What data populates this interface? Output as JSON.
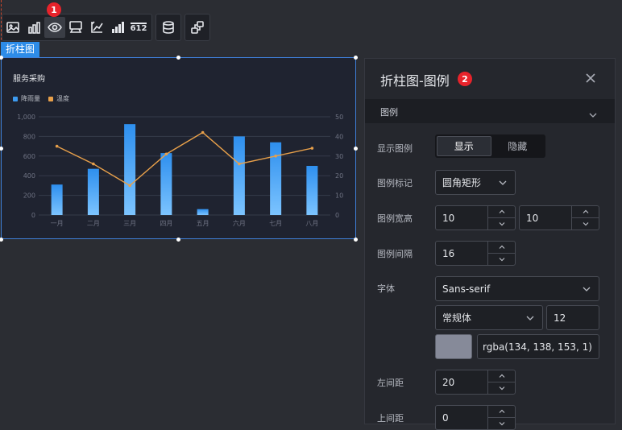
{
  "badges": {
    "first": "1",
    "second": "2"
  },
  "toolbar": {
    "icons": [
      "image-icon",
      "bar-chart-icon",
      "eye-icon",
      "tooltip-icon",
      "axis-icon",
      "bar-series-icon",
      "data-label-icon",
      "database-icon",
      "link-icon"
    ],
    "data_label_text": "612"
  },
  "canvas": {
    "selected_tag": "折柱图"
  },
  "chart_data": {
    "type": "bar",
    "title": "服务采购",
    "categories": [
      "一月",
      "二月",
      "三月",
      "四月",
      "五月",
      "六月",
      "七月",
      "八月"
    ],
    "series": [
      {
        "name": "降雨量",
        "type": "bar",
        "axis": "left",
        "values": [
          310,
          470,
          925,
          630,
          60,
          800,
          740,
          500
        ]
      },
      {
        "name": "温度",
        "type": "line",
        "axis": "right",
        "values": [
          35,
          26,
          15,
          31,
          42,
          26,
          30,
          34
        ]
      }
    ],
    "y_left_ticks": [
      "0",
      "200",
      "400",
      "600",
      "800",
      "1,000"
    ],
    "y_right_ticks": [
      "0",
      "10",
      "20",
      "30",
      "40",
      "50"
    ],
    "y_left_range": [
      0,
      1000
    ],
    "y_right_range": [
      0,
      50
    ],
    "legend_position": "top-left",
    "grid": true,
    "colors": {
      "bar": "#2e8fee",
      "bar_light": "#7cc4ff",
      "line": "#e8a04a"
    }
  },
  "panel": {
    "title": "折柱图-图例",
    "section": "图例",
    "rows": {
      "show_legend": {
        "label": "显示图例",
        "options": [
          "显示",
          "隐藏"
        ],
        "selected": "显示"
      },
      "legend_mark": {
        "label": "图例标记",
        "value": "圆角矩形"
      },
      "legend_size": {
        "label": "图例宽高",
        "width": "10",
        "height": "10"
      },
      "legend_gap": {
        "label": "图例间隔",
        "value": "16"
      },
      "font": {
        "label": "字体",
        "family": "Sans-serif",
        "weight": "常规体",
        "size": "12",
        "color_text": "rgba(134, 138, 153, 1)"
      },
      "left_margin": {
        "label": "左间距",
        "value": "20"
      },
      "top_margin": {
        "label": "上间距",
        "value": "0"
      }
    }
  }
}
